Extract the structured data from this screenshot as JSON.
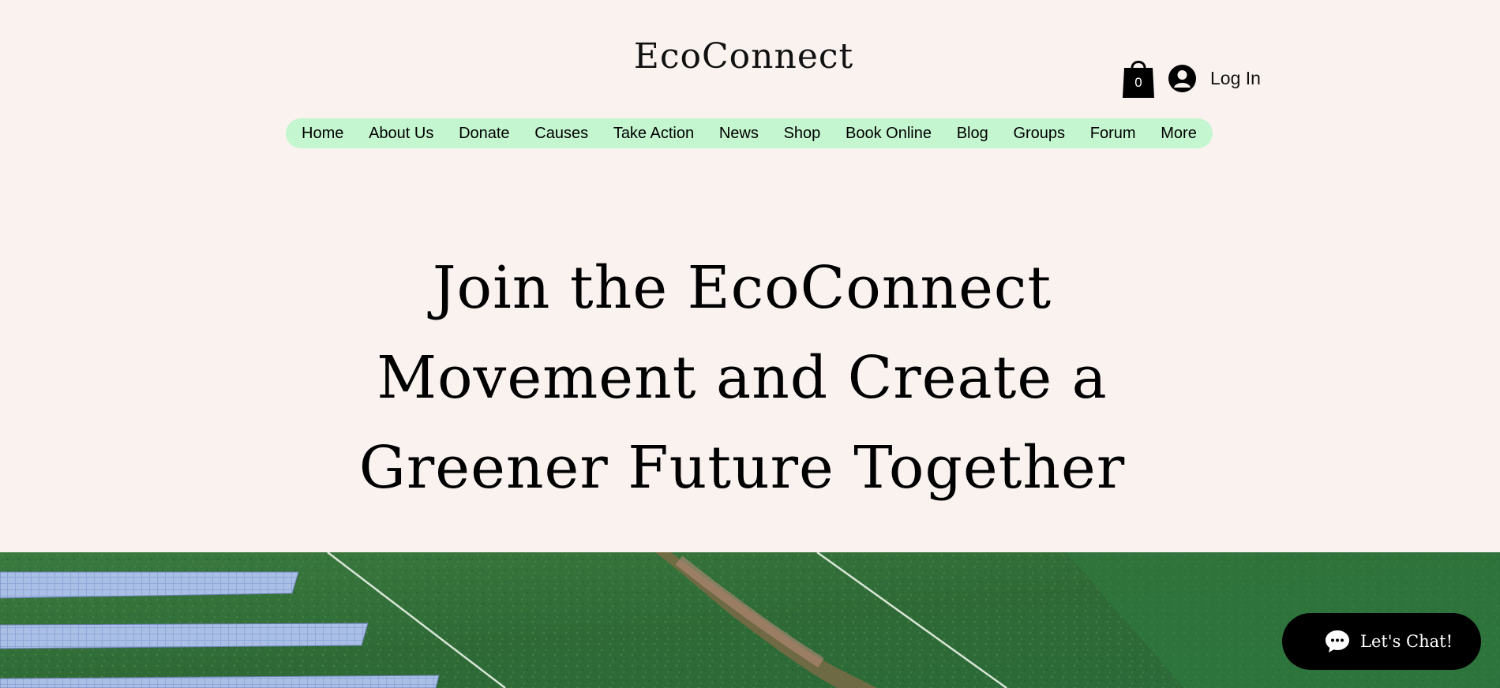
{
  "header": {
    "site_title": "EcoConnect",
    "cart_count": "0",
    "cart_icon": "shopping-bag-icon",
    "login_icon": "user-avatar-icon",
    "login_label": "Log In"
  },
  "nav": {
    "items": [
      {
        "label": "Home"
      },
      {
        "label": "About Us"
      },
      {
        "label": "Donate"
      },
      {
        "label": "Causes"
      },
      {
        "label": "Take Action"
      },
      {
        "label": "News"
      },
      {
        "label": "Shop"
      },
      {
        "label": "Book Online"
      },
      {
        "label": "Blog"
      },
      {
        "label": "Groups"
      },
      {
        "label": "Forum"
      },
      {
        "label": "More"
      }
    ]
  },
  "hero": {
    "title_lines": [
      "Join the EcoConnect",
      "Movement and Create a",
      "Greener Future Together"
    ],
    "image_subject": "aerial view of solar panels in green field"
  },
  "chat": {
    "label": "Let's Chat!",
    "icon": "chat-bubble-icon"
  },
  "colors": {
    "background": "#faf2ef",
    "nav_background": "#c4f6cf",
    "field_green": "#2e6b37",
    "chat_background": "#000000"
  }
}
